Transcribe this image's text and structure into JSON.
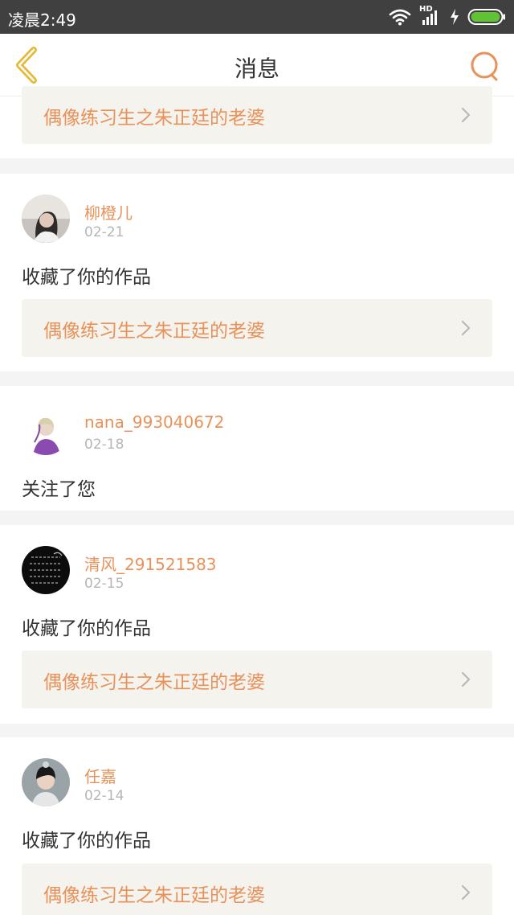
{
  "status_bar": {
    "time": "凌晨2:49",
    "network_label": "HD",
    "icons": [
      "wifi-icon",
      "signal-icon",
      "charging-icon",
      "battery-icon"
    ]
  },
  "header": {
    "title": "消息",
    "back_icon": "chevron-left-icon",
    "search_icon": "search-icon"
  },
  "colors": {
    "accent": "#e8925a",
    "back": "#e7b93a",
    "background": "#f4f4f4",
    "work_box": "#f4f3ee"
  },
  "messages": [
    {
      "user": "",
      "date": "",
      "action": "",
      "work_title": "偶像练习生之朱正廷的老婆"
    },
    {
      "user": "柳橙儿",
      "date": "02-21",
      "action": "收藏了你的作品",
      "work_title": "偶像练习生之朱正廷的老婆"
    },
    {
      "user": "nana_993040672",
      "date": "02-18",
      "action": "关注了您",
      "work_title": ""
    },
    {
      "user": "清风_291521583",
      "date": "02-15",
      "action": "收藏了你的作品",
      "work_title": "偶像练习生之朱正廷的老婆"
    },
    {
      "user": "任嘉",
      "date": "02-14",
      "action": "收藏了你的作品",
      "work_title": "偶像练习生之朱正廷的老婆"
    }
  ]
}
